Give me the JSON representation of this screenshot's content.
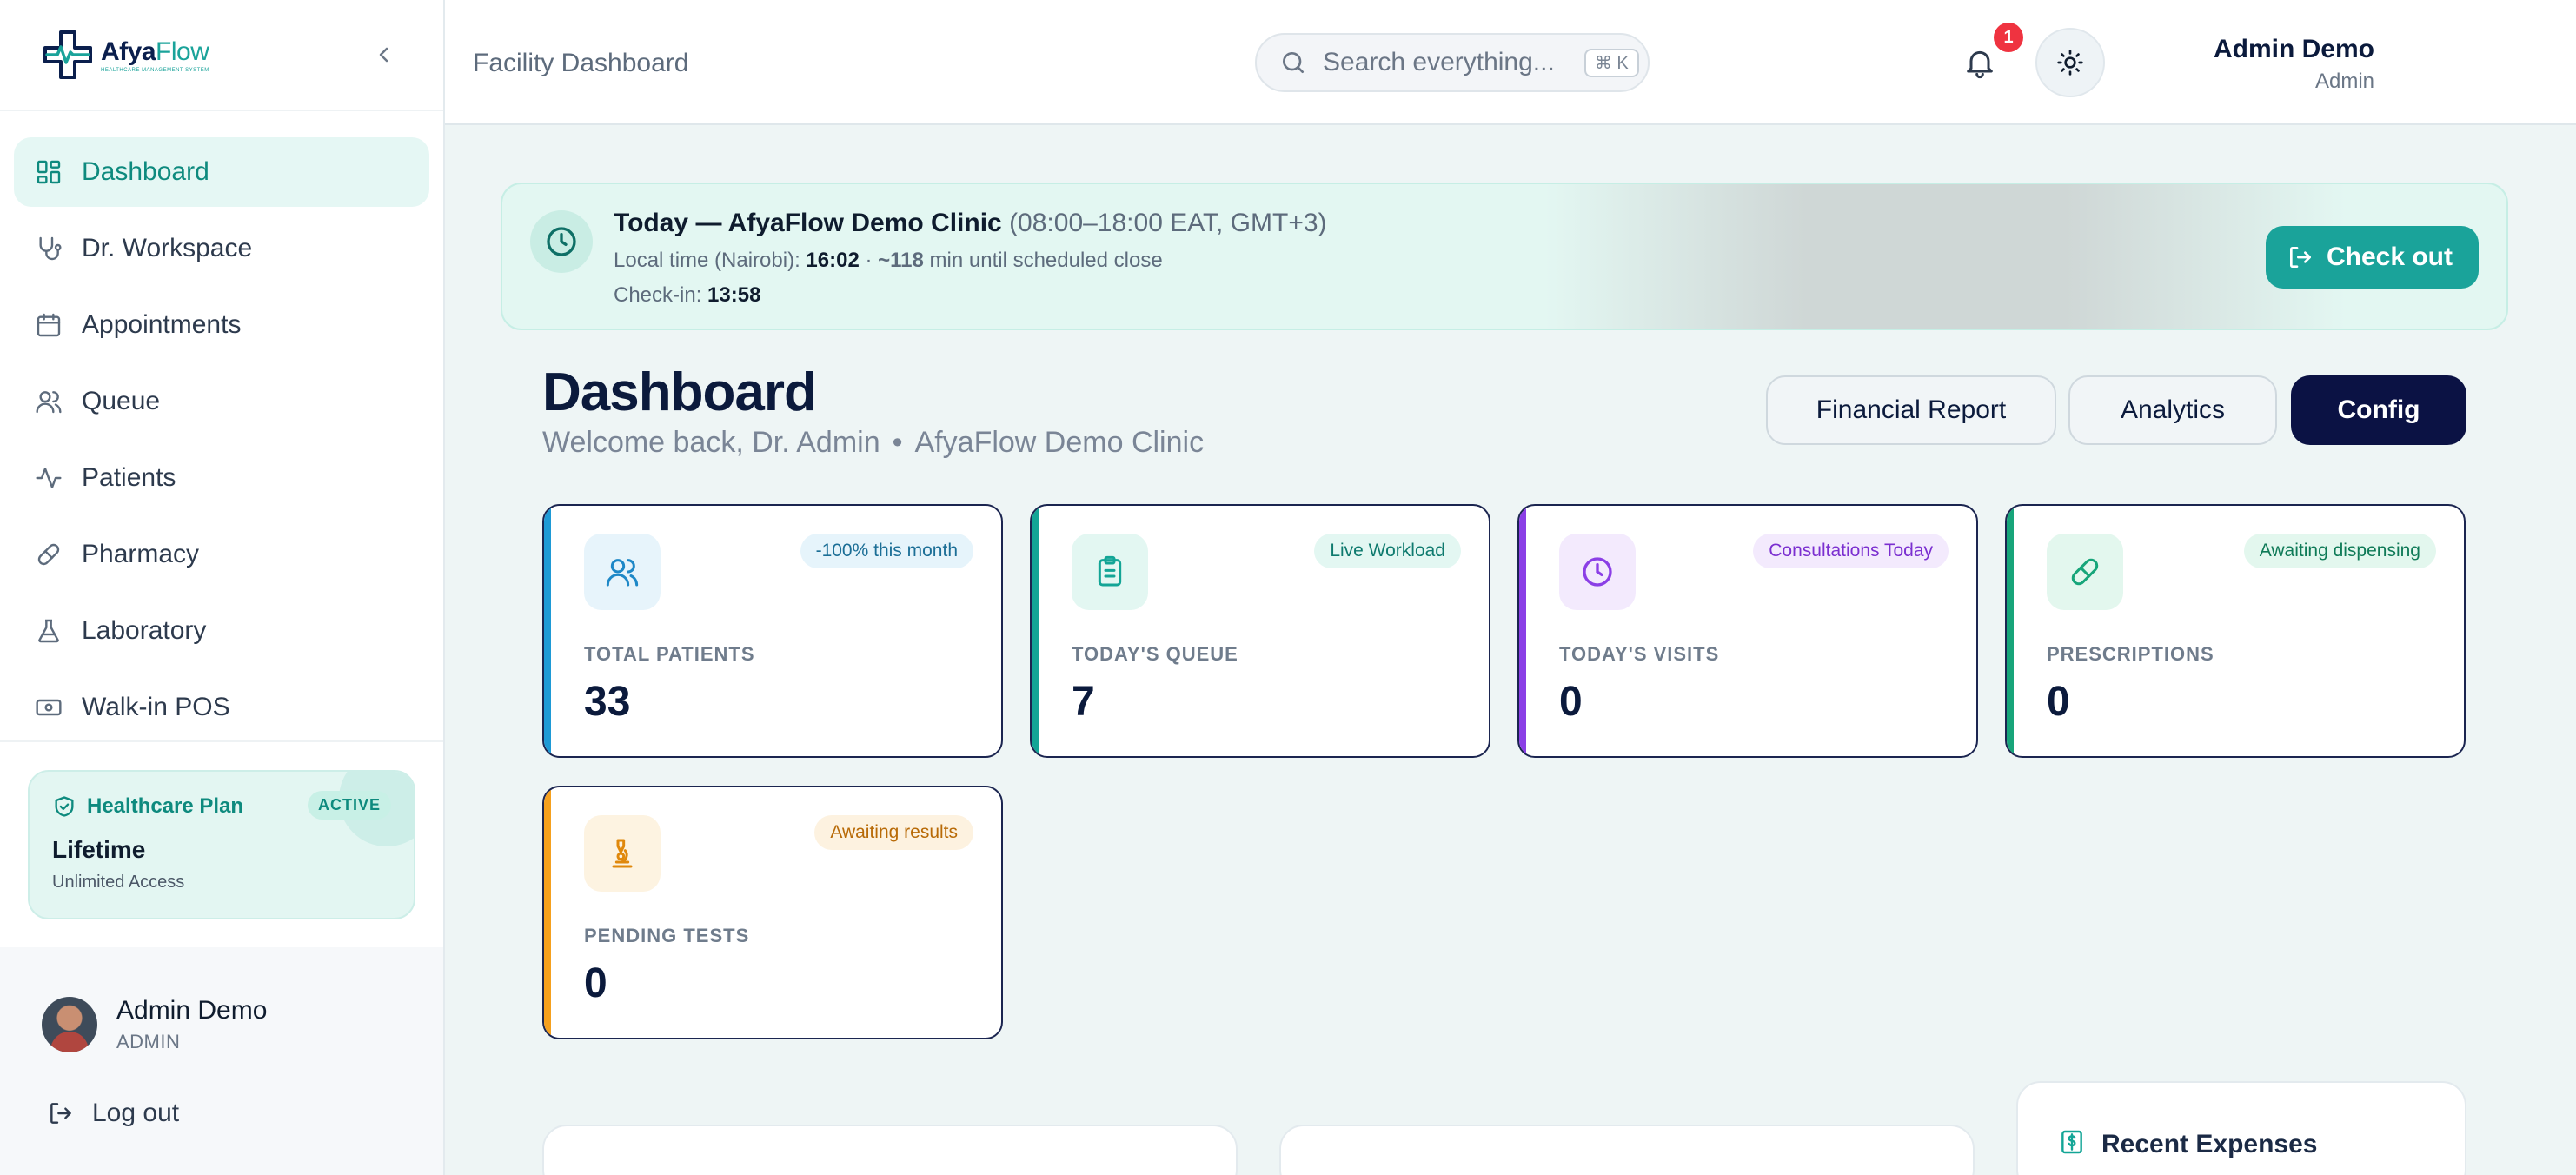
{
  "sidebar": {
    "logo": {
      "name_a": "Afya",
      "name_b": "Flow",
      "tagline": "HEALTHCARE MANAGEMENT SYSTEM"
    },
    "items": [
      {
        "label": "Dashboard",
        "icon": "grid-icon",
        "active": true
      },
      {
        "label": "Dr. Workspace",
        "icon": "stethoscope-icon"
      },
      {
        "label": "Appointments",
        "icon": "calendar-icon"
      },
      {
        "label": "Queue",
        "icon": "users-icon"
      },
      {
        "label": "Patients",
        "icon": "activity-icon"
      },
      {
        "label": "Pharmacy",
        "icon": "pill-icon"
      },
      {
        "label": "Laboratory",
        "icon": "flask-icon"
      },
      {
        "label": "Walk-in POS",
        "icon": "cash-icon"
      }
    ],
    "plan": {
      "label": "Healthcare Plan",
      "badge": "ACTIVE",
      "title": "Lifetime",
      "subtitle": "Unlimited Access"
    },
    "user": {
      "name": "Admin Demo",
      "role": "ADMIN"
    },
    "logout": "Log out"
  },
  "topbar": {
    "page_title": "Facility Dashboard",
    "search_placeholder": "Search everything...",
    "shortcut": "⌘ K",
    "admin_name": "Admin Demo",
    "admin_role": "Admin",
    "notifications": "1"
  },
  "banner": {
    "title": "Today — AfyaFlow Demo Clinic",
    "hours": "(08:00–18:00 EAT, GMT+3)",
    "local_label": "Local time (Nairobi):",
    "local_time": "16:02",
    "sep": "·",
    "minutes": "~118",
    "minutes_label": "min until scheduled close",
    "checkin_label": "Check-in:",
    "checkin_time": "13:58",
    "checkout_label": "Check out"
  },
  "header": {
    "title": "Dashboard",
    "welcome": "Welcome back, Dr. Admin",
    "dot": "•",
    "clinic": "AfyaFlow Demo Clinic",
    "buttons": {
      "financial": "Financial Report",
      "analytics": "Analytics",
      "config": "Config"
    }
  },
  "stats": [
    {
      "label": "TOTAL PATIENTS",
      "value": "33",
      "badge": "-100% this month",
      "accent": "#1e9ad6",
      "badge_bg": "#e6f4fb",
      "badge_color": "#1b6e96",
      "icon_bg": "#e7f4fb",
      "icon_color": "#1e88c7",
      "icon": "users-icon"
    },
    {
      "label": "TODAY'S QUEUE",
      "value": "7",
      "badge": "Live Workload",
      "accent": "#13a596",
      "badge_bg": "#e3f7f2",
      "badge_color": "#0e7a6e",
      "icon_bg": "#e3f7f2",
      "icon_color": "#13a596",
      "icon": "clipboard-icon"
    },
    {
      "label": "TODAY'S VISITS",
      "value": "0",
      "badge": "Consultations Today",
      "accent": "#8b3fe6",
      "badge_bg": "#f3eafd",
      "badge_color": "#7b2fd0",
      "icon_bg": "#f3eafd",
      "icon_color": "#8b3fe6",
      "icon": "clock-icon"
    },
    {
      "label": "PRESCRIPTIONS",
      "value": "0",
      "badge": "Awaiting dispensing",
      "accent": "#17a57a",
      "badge_bg": "#e3f7ee",
      "badge_color": "#0f7a57",
      "icon_bg": "#e3f7ee",
      "icon_color": "#17a57a",
      "icon": "pill-icon"
    },
    {
      "label": "PENDING TESTS",
      "value": "0",
      "badge": "Awaiting results",
      "accent": "#f5a01e",
      "badge_bg": "#fdf2e0",
      "badge_color": "#b86a07",
      "icon_bg": "#fdf3e1",
      "icon_color": "#e0880c",
      "icon": "microscope-icon"
    }
  ],
  "recent_expenses": {
    "title": "Recent Expenses",
    "icon": "dollar-doc-icon"
  }
}
